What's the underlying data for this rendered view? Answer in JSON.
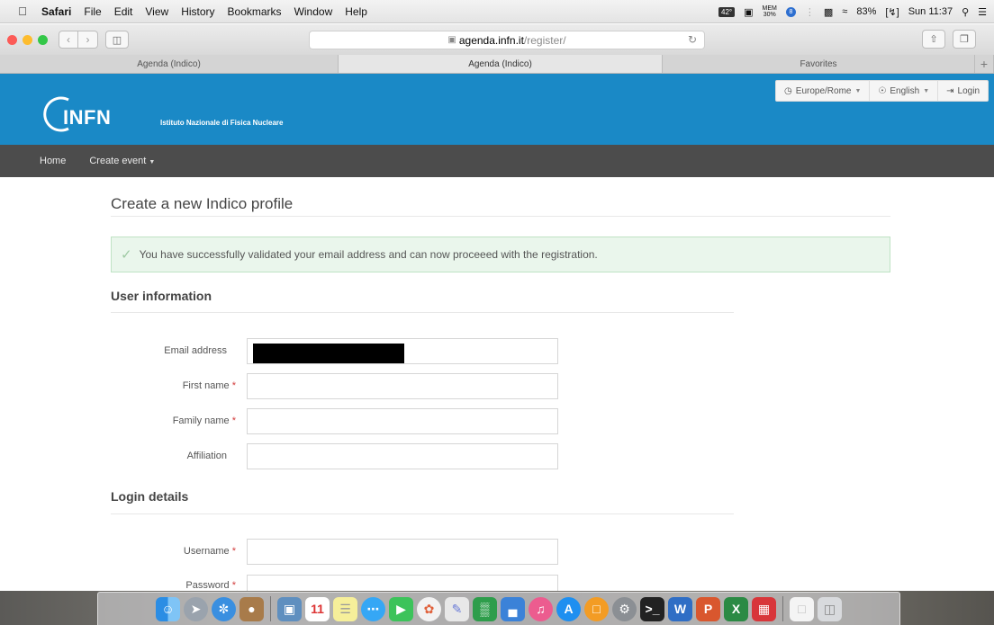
{
  "menubar": {
    "app": "Safari",
    "items": [
      "File",
      "Edit",
      "View",
      "History",
      "Bookmarks",
      "Window",
      "Help"
    ],
    "tray": {
      "temp": "42°",
      "mem_label": "MEM",
      "mem_value": "30%",
      "badge": "8",
      "battery": "83%",
      "clock": "Sun 11:37"
    }
  },
  "toolbar": {
    "url_host": "agenda.infn.it",
    "url_path": "/register/"
  },
  "tabs": [
    "Agenda (Indico)",
    "Agenda (Indico)",
    "Favorites"
  ],
  "header": {
    "logo": "INFN",
    "subtitle": "Istituto Nazionale di Fisica Nucleare",
    "timezone": "Europe/Rome",
    "language": "English",
    "login": "Login"
  },
  "nav": {
    "home": "Home",
    "create_event": "Create event"
  },
  "page": {
    "title": "Create a new Indico profile",
    "alert": "You have successfully validated your email address and can now proceeed with the registration.",
    "section_user": "User information",
    "section_login": "Login details",
    "fields": {
      "email": "Email address",
      "first_name": "First name",
      "family_name": "Family name",
      "affiliation": "Affiliation",
      "username": "Username",
      "password": "Password"
    },
    "required_mark": "*"
  },
  "colors": {
    "header_blue": "#1a89c6",
    "navbar": "#4c4c4c",
    "alert_bg": "#eaf6ec",
    "required": "#d23c3c"
  },
  "dock": [
    "finder-icon",
    "launchpad-icon",
    "safari-icon",
    "contacts-icon",
    "preview-icon",
    "calendar-icon",
    "notes-icon",
    "messages-icon",
    "facetime-icon",
    "photos-icon",
    "textedit-icon",
    "numbers-icon",
    "keynote-icon",
    "itunes-icon",
    "app-store-icon",
    "ibooks-icon",
    "system-preferences-icon",
    "terminal-icon",
    "word-icon",
    "powerpoint-icon",
    "excel-icon",
    "parallels-icon",
    "documents-icon",
    "trash-icon"
  ]
}
